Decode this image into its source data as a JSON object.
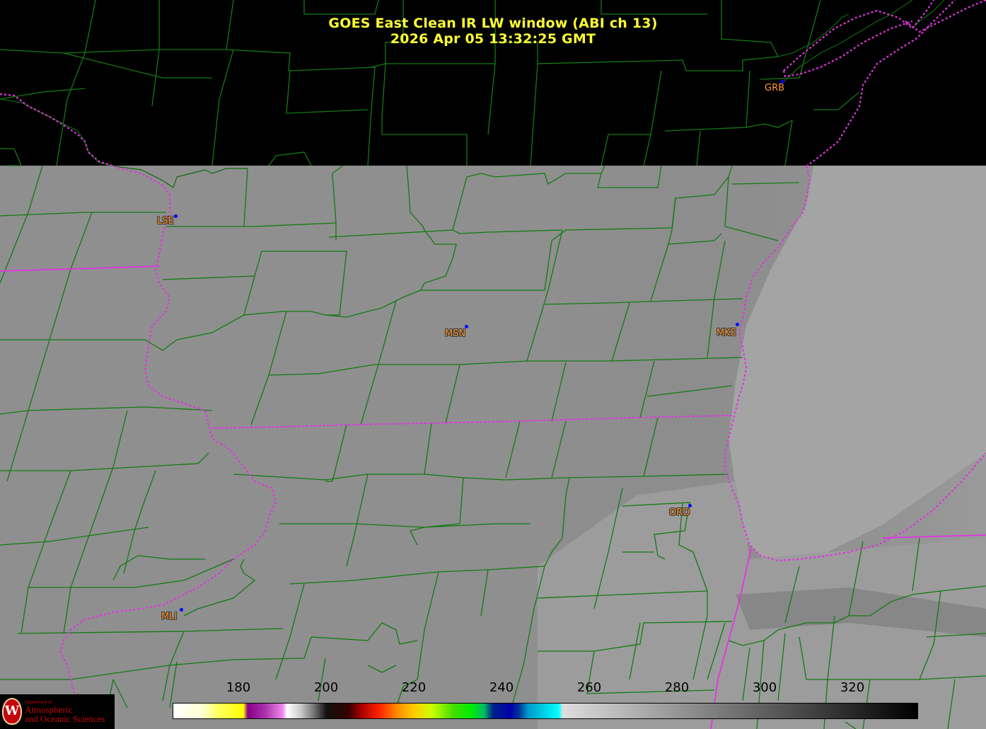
{
  "title": {
    "line1": "GOES East Clean IR LW window (ABI ch 13)",
    "line2": "2026 Apr 05  13:32:25 GMT"
  },
  "stations": [
    {
      "code": "GRB"
    },
    {
      "code": "LSE"
    },
    {
      "code": "MSN"
    },
    {
      "code": "MKE"
    },
    {
      "code": "ORD"
    },
    {
      "code": "MLI"
    }
  ],
  "colorbar": {
    "min": 165,
    "max": 335,
    "tick_labels": [
      "180",
      "200",
      "220",
      "240",
      "260",
      "280",
      "300",
      "320"
    ],
    "ticks": [
      180,
      200,
      220,
      240,
      260,
      280,
      300,
      320
    ]
  },
  "logo": {
    "line1": "Department of",
    "line2": "Atmospheric",
    "line3": "and Oceanic Sciences",
    "seal": "W"
  },
  "colors": {
    "title": "#ffff33",
    "county_lines": "#127a12",
    "state_lines": "#e233e2",
    "station_label": "#ff9933",
    "station_dot": "#0000ff"
  }
}
